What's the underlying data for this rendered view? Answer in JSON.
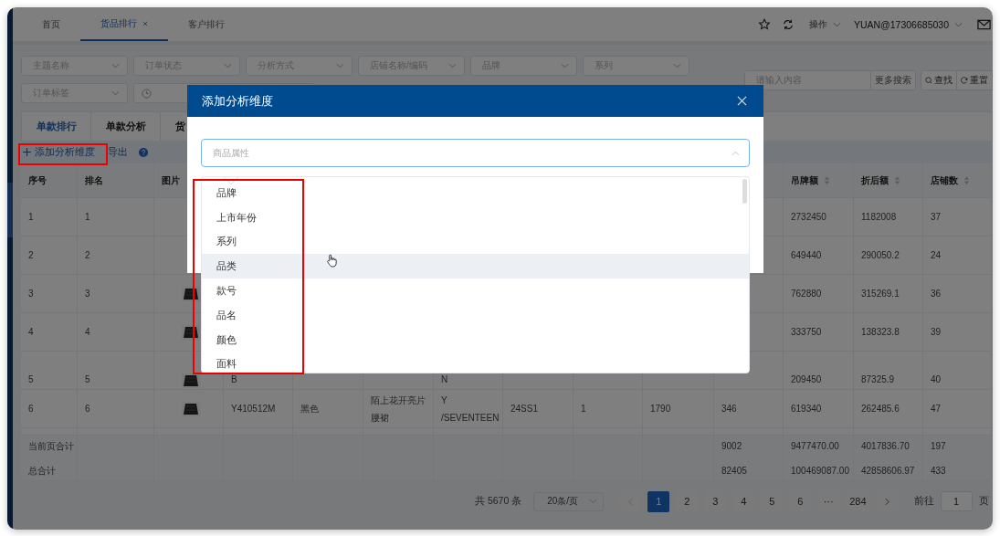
{
  "tabs": [
    {
      "label": "首页",
      "selected": false,
      "closable": false
    },
    {
      "label": "货品排行",
      "selected": true,
      "closable": true
    },
    {
      "label": "客户排行",
      "selected": false,
      "closable": false
    }
  ],
  "header_actions": {
    "menu": "操作",
    "user": "YUAN@17306685030"
  },
  "filters": [
    {
      "kind": "select",
      "placeholder": "主题名称"
    },
    {
      "kind": "select",
      "placeholder": "订单状态"
    },
    {
      "kind": "select",
      "placeholder": "分析方式"
    },
    {
      "kind": "select",
      "placeholder": "店铺名称/编码"
    },
    {
      "kind": "select",
      "placeholder": "品牌"
    },
    {
      "kind": "select",
      "placeholder": "系列"
    }
  ],
  "filters_2": [
    {
      "kind": "select",
      "placeholder": "订单标签"
    },
    {
      "kind": "date"
    }
  ],
  "search": {
    "placeholder": "请输入内容",
    "more": "更多搜索",
    "find": "查找",
    "reset": "重置"
  },
  "view_tabs": [
    {
      "label": "单款排行",
      "selected": true
    },
    {
      "label": "单款分析",
      "selected": false
    },
    {
      "label": "货",
      "selected": false
    }
  ],
  "toolbar": {
    "add": "添加分析维度",
    "export": "导出"
  },
  "table": {
    "columns": [
      {
        "label": "序号",
        "sortable": false
      },
      {
        "label": "排名",
        "sortable": false
      },
      {
        "label": "图片",
        "sortable": false
      },
      {
        "label": "吊牌额",
        "sortable": true
      },
      {
        "label": "折后额",
        "sortable": true
      },
      {
        "label": "店铺数",
        "sortable": true
      }
    ],
    "rows": [
      {
        "clipped_top": false,
        "no": "1",
        "rank": "1",
        "tag_amount": "2732450",
        "discount_amount": "1182008",
        "store_count": "37"
      },
      {
        "clipped_top": false,
        "no": "2",
        "rank": "2",
        "tag_amount": "649440",
        "discount_amount": "290050.2",
        "store_count": "24"
      },
      {
        "clipped_top": false,
        "no": "3",
        "rank": "3",
        "tag_amount": "762880",
        "discount_amount": "315269.1",
        "store_count": "36"
      },
      {
        "clipped_top": false,
        "no": "4",
        "rank": "4",
        "tag_amount": "333750",
        "discount_amount": "138323.8",
        "store_count": "39"
      },
      {
        "clipped_top": true,
        "no": "5",
        "rank": "5",
        "column_4": "B",
        "column_7": "N",
        "tag_amount": "209450",
        "discount_amount": "87325.9",
        "store_count": "40"
      },
      {
        "clipped_top": false,
        "no": "6",
        "rank": "6",
        "column_4": "Y410512M",
        "column_5": "黑色",
        "column_6": "陌上花开亮片腰裙",
        "column_7": "Y /SEVENTEEN",
        "column_8": "24SS1",
        "column_9": "1",
        "column_10": "1790",
        "column_11": "346",
        "tag_amount": "619340",
        "discount_amount": "262485.6",
        "store_count": "47"
      }
    ],
    "totals": [
      {
        "no": "当前页合计",
        "column_11": "9002",
        "tag_amount": "9477470.00",
        "discount_amount": "4017836.70",
        "store_count": "197"
      },
      {
        "no": "总合计",
        "column_11": "82405",
        "tag_amount": "100469087.00",
        "discount_amount": "42858606.97",
        "store_count": "433"
      }
    ]
  },
  "pagination": {
    "total": "共 5670 条",
    "page_size": "20条/页",
    "pages": [
      {
        "label": "1",
        "selected": true
      },
      {
        "label": "2",
        "selected": false
      },
      {
        "label": "3",
        "selected": false
      },
      {
        "label": "4",
        "selected": false
      },
      {
        "label": "5",
        "selected": false
      },
      {
        "label": "6",
        "selected": false
      },
      {
        "label": "···",
        "selected": false
      },
      {
        "label": "284",
        "selected": false
      }
    ],
    "goto": "前往",
    "page_input": "1",
    "page_unit": "页"
  },
  "dialog": {
    "title": "添加分析维度",
    "select": {
      "placeholder": "商品属性",
      "open": true
    },
    "options": [
      {
        "label": "品牌",
        "hovered": false
      },
      {
        "label": "上市年份",
        "hovered": false
      },
      {
        "label": "系列",
        "hovered": false
      },
      {
        "label": "品类",
        "hovered": true
      },
      {
        "label": "款号",
        "hovered": false
      },
      {
        "label": "品名",
        "hovered": false
      },
      {
        "label": "颜色",
        "hovered": false
      },
      {
        "label": "面料",
        "hovered": false
      }
    ]
  }
}
